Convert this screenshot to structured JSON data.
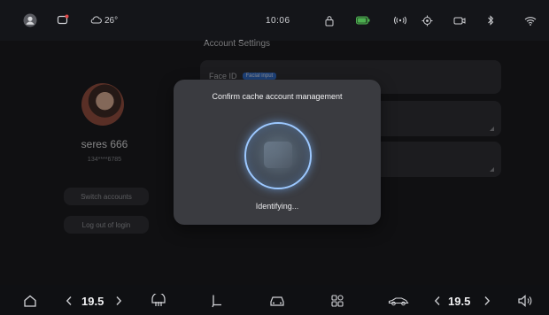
{
  "status_bar": {
    "weather_temp": "26°",
    "time": "10:06"
  },
  "page_title": "Account Settings",
  "profile": {
    "name": "seres 666",
    "phone": "134****6785",
    "switch_accounts": "Switch accounts",
    "logout": "Log out of login"
  },
  "cards": [
    {
      "label": "Face ID",
      "tag": "Facial input"
    }
  ],
  "modal": {
    "title": "Confirm cache account management",
    "status": "Identifying..."
  },
  "dock": {
    "left_temp": "19.5",
    "right_temp": "19.5"
  }
}
